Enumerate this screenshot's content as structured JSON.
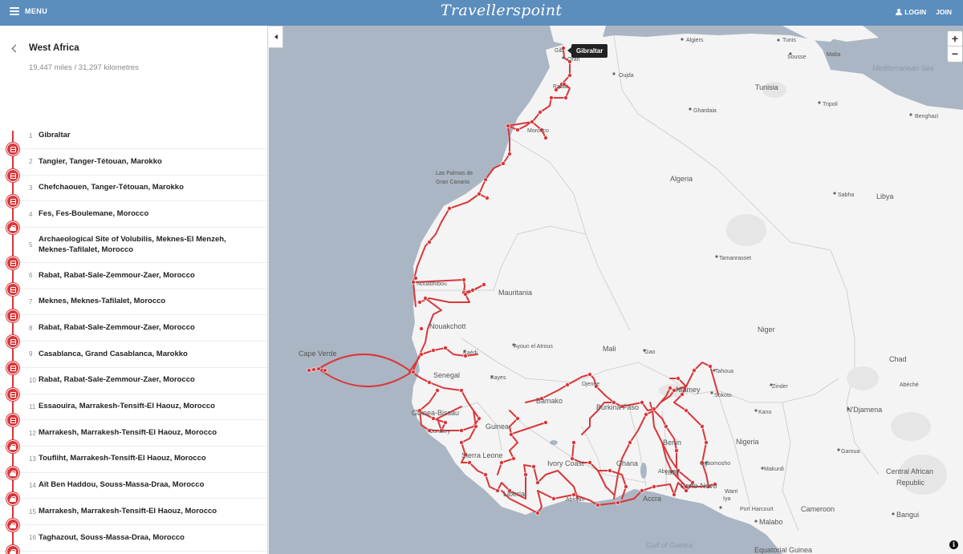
{
  "header": {
    "menu_label": "MENU",
    "logo_text": "Travellerspoint",
    "login_label": "LOGIN",
    "join_label": "JOIN"
  },
  "trip": {
    "title": "West Africa",
    "distance": "19,447 miles / 31,297 kilometres"
  },
  "stops": [
    {
      "num": "1",
      "name": "Gibraltar",
      "transport": null
    },
    {
      "num": "2",
      "name": "Tangier, Tanger-Tétouan, Marokko",
      "transport": "bus"
    },
    {
      "num": "3",
      "name": "Chefchaouen, Tanger-Tétouan, Marokko",
      "transport": "bus"
    },
    {
      "num": "4",
      "name": "Fes, Fes-Boulemane, Morocco",
      "transport": "bus"
    },
    {
      "num": "5",
      "name": "Archaeological Site of Volubilis, Meknes-El Menzeh, Meknes-Tafilalet, Morocco",
      "transport": "car"
    },
    {
      "num": "6",
      "name": "Rabat, Rabat-Sale-Zemmour-Zaer, Morocco",
      "transport": "bus"
    },
    {
      "num": "7",
      "name": "Meknes, Meknes-Tafilalet, Morocco",
      "transport": "bus"
    },
    {
      "num": "8",
      "name": "Rabat, Rabat-Sale-Zemmour-Zaer, Morocco",
      "transport": "bus"
    },
    {
      "num": "9",
      "name": "Casablanca, Grand Casablanca, Marokko",
      "transport": "bus"
    },
    {
      "num": "10",
      "name": "Rabat, Rabat-Sale-Zemmour-Zaer, Morocco",
      "transport": "bus"
    },
    {
      "num": "11",
      "name": "Essaouira, Marrakesh-Tensift-El Haouz, Morocco",
      "transport": "bus"
    },
    {
      "num": "12",
      "name": "Marrakesh, Marrakesh-Tensift-El Haouz, Morocco",
      "transport": "bus"
    },
    {
      "num": "13",
      "name": "Toufliht, Marrakesh-Tensift-El Haouz, Morocco",
      "transport": "car"
    },
    {
      "num": "14",
      "name": "Aït Ben Haddou, Souss-Massa-Draa, Morocco",
      "transport": "car"
    },
    {
      "num": "15",
      "name": "Marrakesh, Marrakesh-Tensift-El Haouz, Morocco",
      "transport": "car"
    },
    {
      "num": "16",
      "name": "Taghazout, Souss-Massa-Draa, Morocco",
      "transport": "car"
    }
  ],
  "map": {
    "collapse_icon": "chevron-left-icon",
    "zoom_in": "+",
    "zoom_out": "−",
    "tooltip": "Gibraltar",
    "info": "i",
    "route_color": "#d9373a",
    "water_color": "#aab6c3",
    "land_color": "#f4f4f4",
    "labels": {
      "algiers": "Algiers",
      "tunis": "Tunis",
      "malta": "Malta",
      "sousse": "Sousse",
      "mediterranean": "Mediterranean Sea",
      "rabat": "Rabat",
      "gibraltar": "Gib",
      "oran": "Oran",
      "oujda": "Oujda",
      "tunisia": "Tunisia",
      "tripoli": "Tripoli",
      "ghardaia": "Ghardaia",
      "benghazi": "Benghazi",
      "morocco": "Morocco",
      "las_palmas_1": "Las Palmas de",
      "las_palmas_2": "Gran Canaria",
      "algeria": "Algeria",
      "sabha": "Sabha",
      "libya": "Libya",
      "tamanrasset": "Tamanrasset",
      "nouadhibou": "Nouadhibou",
      "mauritania": "Mauritania",
      "nouakchott": "Nouakchott",
      "kaedi": "Kaédi",
      "ayoun": "Ayoun el Atrous",
      "mali": "Mali",
      "gao": "Gao",
      "niger": "Niger",
      "chad": "Chad",
      "cape_verde": "Cape Verde",
      "senegal": "Senegal",
      "kayes": "Kayes",
      "tahoua": "Tahoua",
      "zinder": "Zinder",
      "abeche": "Abéché",
      "djenne": "Djenne",
      "niamey": "Niamey",
      "sokoto": "Sokoto",
      "bamako": "Bamako",
      "guinea_bissau": "Guinea-Bissau",
      "burkina_faso": "Burkina Faso",
      "kano": "Kano",
      "ndjamena": "N'Djamena",
      "guinea": "Guinea",
      "benin": "Benin",
      "garoua": "Garoua",
      "nigeria": "Nigeria",
      "sierra_leone": "Sierra Leone",
      "ivory_coast": "Ivory Coast",
      "ghana": "Ghana",
      "abomey": "Abomey",
      "ogbomosho": "Ogbomosho",
      "makurdi": "Makurdi",
      "car": "Central African",
      "car2": "Republic",
      "porto_novo": "Porto-Novo",
      "liberia": "Liberia",
      "accra": "Accra",
      "warri": "Warri",
      "iya": "Iya",
      "port_harcourt": "Port Harcourt",
      "cameroon": "Cameroon",
      "bangui": "Bangui",
      "malabo": "Malabo",
      "gulf_of_guinea": "Gulf of Guinea",
      "eq_guinea": "Equatorial Guinea",
      "abidjan": "Abidjan",
      "lome": "Lomé",
      "conakry": "Conakry"
    }
  }
}
